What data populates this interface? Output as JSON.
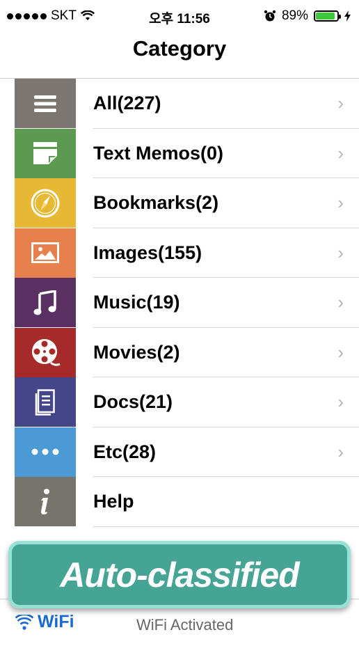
{
  "status_bar": {
    "carrier": "SKT",
    "time": "오후 11:56",
    "battery_percent": "89%",
    "battery_level": 0.89
  },
  "header": {
    "title": "Category"
  },
  "categories": [
    {
      "label": "All(227)",
      "color": "#7b7672",
      "icon": "menu-lines-icon",
      "chevron": "›"
    },
    {
      "label": "Text Memos(0)",
      "color": "#5c9a52",
      "icon": "memo-note-icon",
      "chevron": "›"
    },
    {
      "label": "Bookmarks(2)",
      "color": "#e7b834",
      "icon": "compass-icon",
      "chevron": "›"
    },
    {
      "label": "Images(155)",
      "color": "#e8804e",
      "icon": "picture-icon",
      "chevron": "›"
    },
    {
      "label": "Music(19)",
      "color": "#5a2f62",
      "icon": "music-note-icon",
      "chevron": "›"
    },
    {
      "label": "Movies(2)",
      "color": "#a72a2b",
      "icon": "film-reel-icon",
      "chevron": "›"
    },
    {
      "label": "Docs(21)",
      "color": "#45458a",
      "icon": "document-icon",
      "chevron": "›"
    },
    {
      "label": "Etc(28)",
      "color": "#4b9ad6",
      "icon": "more-dots-icon",
      "chevron": "›"
    },
    {
      "label": "Help",
      "color": "#77746d",
      "icon": "info-icon"
    }
  ],
  "banner": {
    "text": "Auto-classified",
    "bg_color": "#45a494",
    "border_color": "#96e0d4"
  },
  "bottom_bar": {
    "wifi_label": "WiFi",
    "wifi_status": "WiFi Activated",
    "accent": "#1a6ad4"
  }
}
